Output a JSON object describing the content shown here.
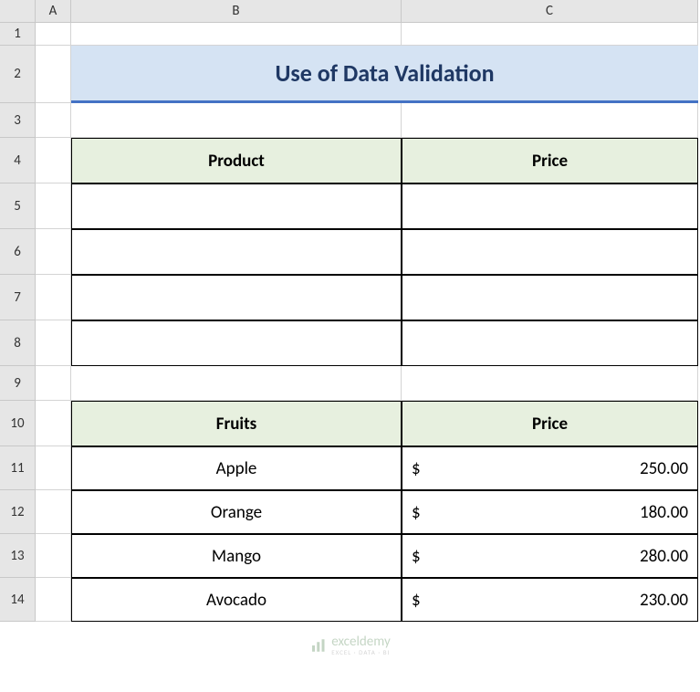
{
  "columns": [
    "A",
    "B",
    "C"
  ],
  "rows": [
    "1",
    "2",
    "3",
    "4",
    "5",
    "6",
    "7",
    "8",
    "9",
    "10",
    "11",
    "12",
    "13",
    "14"
  ],
  "title": "Use of Data Validation",
  "table1": {
    "headers": [
      "Product",
      "Price"
    ],
    "rows": [
      {
        "product": "",
        "price": ""
      },
      {
        "product": "",
        "price": ""
      },
      {
        "product": "",
        "price": ""
      },
      {
        "product": "",
        "price": ""
      }
    ]
  },
  "table2": {
    "headers": [
      "Fruits",
      "Price"
    ],
    "rows": [
      {
        "fruit": "Apple",
        "currency": "$",
        "price": "250.00"
      },
      {
        "fruit": "Orange",
        "currency": "$",
        "price": "180.00"
      },
      {
        "fruit": "Mango",
        "currency": "$",
        "price": "280.00"
      },
      {
        "fruit": "Avocado",
        "currency": "$",
        "price": "230.00"
      }
    ]
  },
  "watermark": {
    "brand": "exceldemy",
    "sub": "EXCEL · DATA · BI"
  },
  "chart_data": {
    "type": "table",
    "title": "Use of Data Validation",
    "tables": [
      {
        "name": "Product/Price",
        "columns": [
          "Product",
          "Price"
        ],
        "rows": []
      },
      {
        "name": "Fruits/Price",
        "columns": [
          "Fruits",
          "Price"
        ],
        "rows": [
          [
            "Apple",
            250.0
          ],
          [
            "Orange",
            180.0
          ],
          [
            "Mango",
            280.0
          ],
          [
            "Avocado",
            230.0
          ]
        ]
      }
    ]
  }
}
